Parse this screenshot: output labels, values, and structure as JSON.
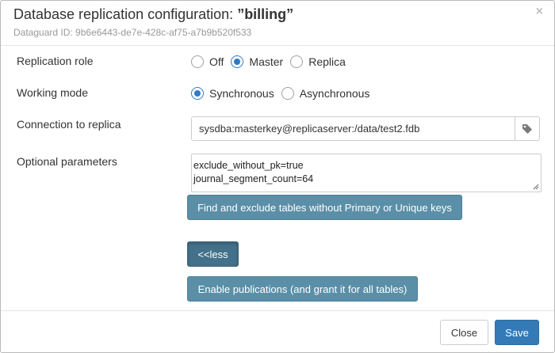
{
  "dialog": {
    "title_prefix": "Database replication configuration: ",
    "title_db": "”billing”",
    "subtitle": "Dataguard ID: 9b6e6443-de7e-428c-af75-a7b9b520f533",
    "close_symbol": "×"
  },
  "form": {
    "replication_role": {
      "label": "Replication role",
      "options": [
        "Off",
        "Master",
        "Replica"
      ],
      "selected": "Master"
    },
    "working_mode": {
      "label": "Working mode",
      "options": [
        "Synchronous",
        "Asynchronous"
      ],
      "selected": "Synchronous"
    },
    "connection": {
      "label": "Connection to replica",
      "value": "sysdba:masterkey@replicaserver:/data/test2.fdb",
      "addon_icon": "tag-icon"
    },
    "optional_parameters": {
      "label": "Optional parameters",
      "lines": [
        "exclude_without_pk=true",
        "journal_segment_count=64"
      ]
    }
  },
  "buttons": {
    "find_exclude": "Find and exclude tables without Primary or Unique keys",
    "less": "<<less",
    "enable_publications": "Enable publications (and grant it for all tables)"
  },
  "footer": {
    "close": "Close",
    "save": "Save"
  },
  "colors": {
    "accent": "#3079c7",
    "info_button": "#5b8fa8",
    "info_button_active": "#44718a",
    "primary_button": "#337ab7"
  }
}
